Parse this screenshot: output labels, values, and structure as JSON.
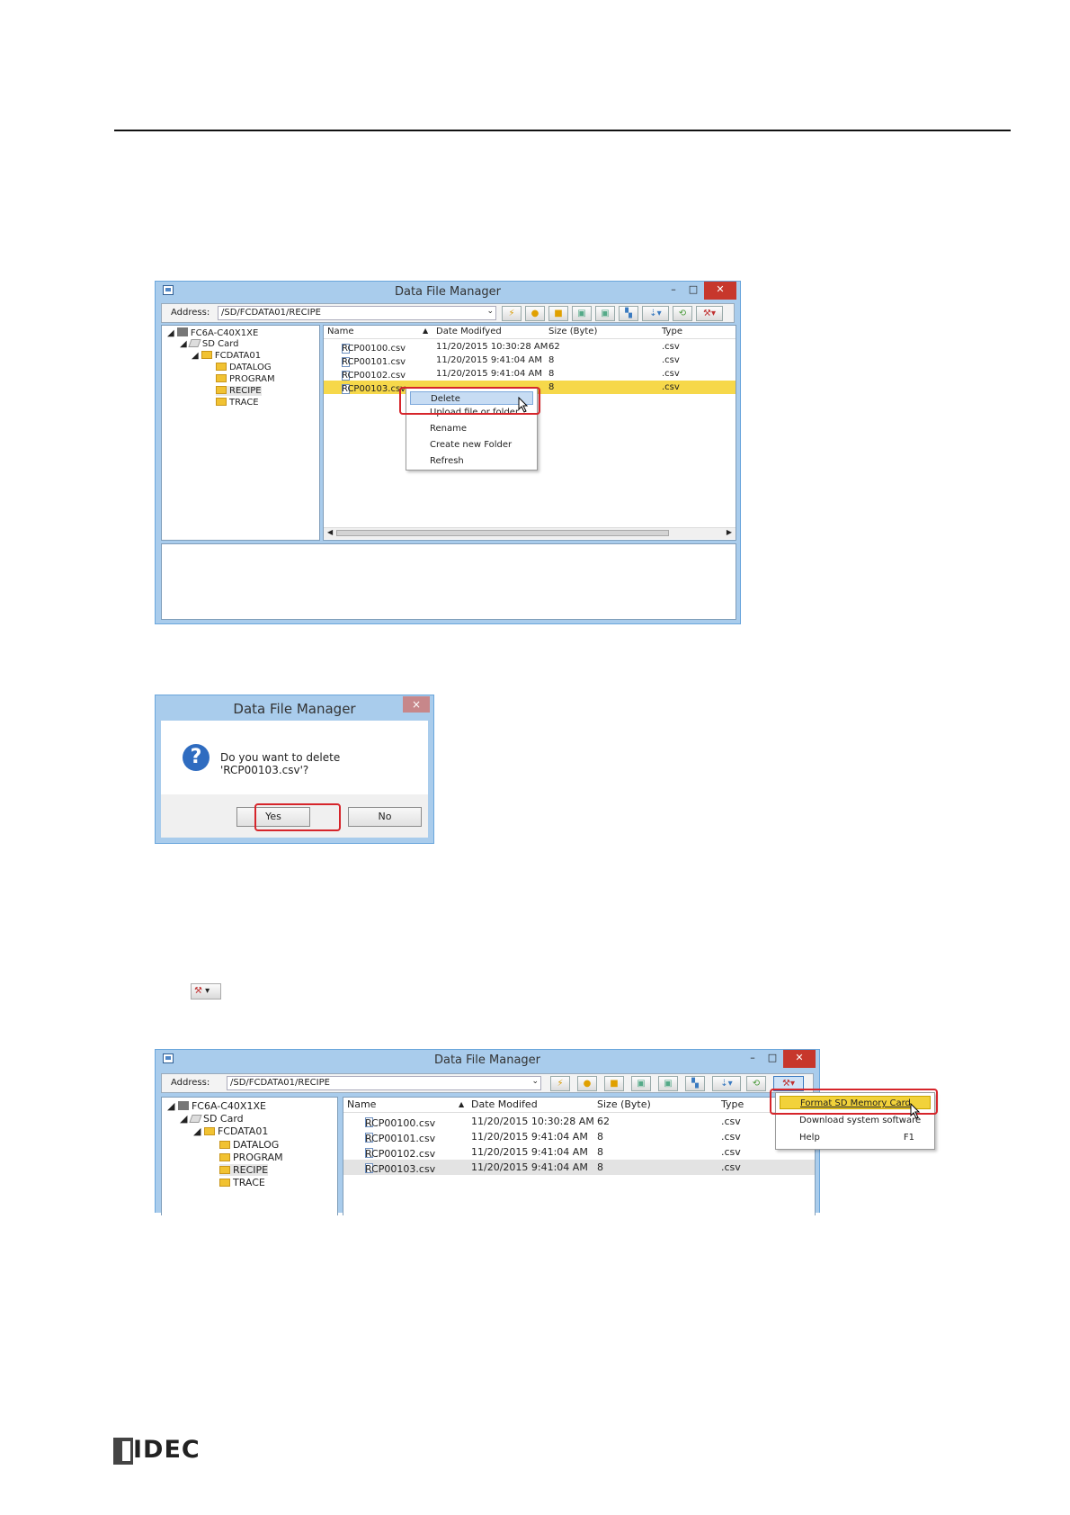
{
  "logo": {
    "text": "IDEC"
  },
  "window1": {
    "title": "Data File Manager",
    "address_label": "Address:",
    "address_value": "/SD/FCDATA01/RECIPE",
    "tree": [
      {
        "label": "FC6A-C40X1XE"
      },
      {
        "label": "SD Card"
      },
      {
        "label": "FCDATA01"
      },
      {
        "label": "DATALOG"
      },
      {
        "label": "PROGRAM"
      },
      {
        "label": "RECIPE"
      },
      {
        "label": "TRACE"
      }
    ],
    "columns": [
      "Name",
      "Date Modifyed",
      "Size (Byte)",
      "Type"
    ],
    "rows": [
      {
        "name": "RCP00100.csv",
        "date": "11/20/2015 10:30:28 AM",
        "size": "62",
        "type": ".csv"
      },
      {
        "name": "RCP00101.csv",
        "date": "11/20/2015 9:41:04 AM",
        "size": "8",
        "type": ".csv"
      },
      {
        "name": "RCP00102.csv",
        "date": "11/20/2015 9:41:04 AM",
        "size": "8",
        "type": ".csv"
      },
      {
        "name": "RCP00103.csv",
        "date": "",
        "size": "8",
        "type": ".csv"
      }
    ],
    "context_menu": [
      "Delete",
      "Upload file or folder",
      "Rename",
      "Create new Folder",
      "Refresh"
    ]
  },
  "dialog": {
    "title": "Data File Manager",
    "close": "×",
    "message": "Do you want to delete 'RCP00103.csv'?",
    "yes": "Yes",
    "no": "No"
  },
  "window2": {
    "title": "Data File Manager",
    "address_label": "Address:",
    "address_value": "/SD/FCDATA01/RECIPE",
    "tree": [
      {
        "label": "FC6A-C40X1XE"
      },
      {
        "label": "SD Card"
      },
      {
        "label": "FCDATA01"
      },
      {
        "label": "DATALOG"
      },
      {
        "label": "PROGRAM"
      },
      {
        "label": "RECIPE"
      },
      {
        "label": "TRACE"
      }
    ],
    "columns": [
      "Name",
      "Date Modifed",
      "Size (Byte)",
      "Type"
    ],
    "rows": [
      {
        "name": "RCP00100.csv",
        "date": "11/20/2015 10:30:28 AM",
        "size": "62",
        "type": ".csv"
      },
      {
        "name": "RCP00101.csv",
        "date": "11/20/2015 9:41:04 AM",
        "size": "8",
        "type": ".csv"
      },
      {
        "name": "RCP00102.csv",
        "date": "11/20/2015 9:41:04 AM",
        "size": "8",
        "type": ".csv"
      },
      {
        "name": "RCP00103.csv",
        "date": "11/20/2015 9:41:04 AM",
        "size": "8",
        "type": ".csv"
      }
    ],
    "tools_menu": [
      {
        "label": "Format SD Memory Card",
        "shortcut": ""
      },
      {
        "label": "Download system software",
        "shortcut": ""
      },
      {
        "label": "Help",
        "shortcut": "F1"
      }
    ]
  }
}
